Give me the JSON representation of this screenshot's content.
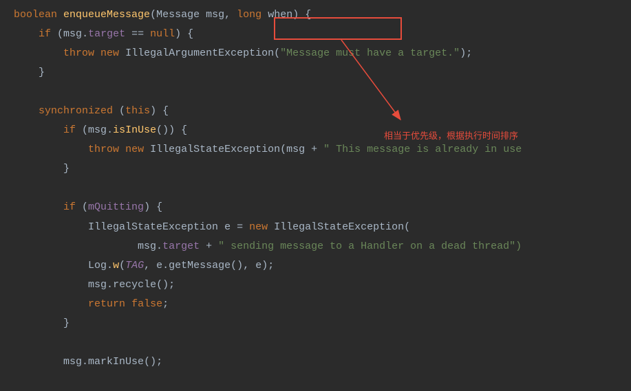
{
  "code": {
    "line1": {
      "kw_boolean": "boolean",
      "method": "enqueueMessage",
      "lparen": "(",
      "type_msg": "Message",
      "param_msg": "msg",
      "comma": ",",
      "kw_long": "long",
      "param_when": "when",
      "rparen_brace": ") {"
    },
    "line2": {
      "kw_if": "if",
      "lparen": " (",
      "var_msg": "msg",
      "dot": ".",
      "field_target": "target",
      "eq": " == ",
      "kw_null": "null",
      "rparen_brace": ") {"
    },
    "line3": {
      "kw_throw": "throw",
      "sp": " ",
      "kw_new": "new",
      "sp2": " ",
      "class": "IllegalArgumentException",
      "lparen": "(",
      "str": "\"Message must have a target.\"",
      "rparen_semi": ");"
    },
    "line4": {
      "brace": "}"
    },
    "line5": {
      "kw_sync": "synchronized",
      "sp": " (",
      "kw_this": "this",
      "rparen_brace": ") {"
    },
    "line6": {
      "kw_if": "if",
      "lparen": " (",
      "var_msg": "msg",
      "dot": ".",
      "method": "isInUse",
      "paren": "()",
      "rparen_brace": ") {"
    },
    "line7": {
      "kw_throw": "throw",
      "sp": " ",
      "kw_new": "new",
      "sp2": " ",
      "class": "IllegalStateException",
      "lparen": "(",
      "var_msg": "msg",
      "plus": " + ",
      "str": "\" This message is already in use"
    },
    "line8": {
      "brace": "}"
    },
    "line9": {
      "kw_if": "if",
      "lparen": " (",
      "field": "mQuitting",
      "rparen_brace": ") {"
    },
    "line10": {
      "class": "IllegalStateException",
      "var_e": " e ",
      "eq": "= ",
      "kw_new": "new",
      "sp": " ",
      "class2": "IllegalStateException",
      "lparen": "("
    },
    "line11": {
      "var_msg": "msg",
      "dot": ".",
      "field_target": "target",
      "plus": " + ",
      "str": "\" sending message to a Handler on a dead thread\")"
    },
    "line12": {
      "class_log": "Log",
      "dot": ".",
      "method_w": "w",
      "lparen": "(",
      "const_tag": "TAG",
      "comma": ", ",
      "var_e": "e",
      "dot2": ".",
      "method_get": "getMessage",
      "paren": "()",
      "comma2": ", ",
      "var_e2": "e",
      "rparen_semi": ");"
    },
    "line13": {
      "var_msg": "msg",
      "dot": ".",
      "method": "recycle",
      "paren_semi": "();"
    },
    "line14": {
      "kw_return": "return",
      "sp": " ",
      "kw_false": "false",
      "semi": ";"
    },
    "line15": {
      "brace": "}"
    },
    "line16": {
      "var_msg": "msg",
      "dot": ".",
      "method": "markInUse",
      "paren_semi": "();"
    }
  },
  "annotation": {
    "text": "相当于优先级，根据执行时间排序"
  }
}
